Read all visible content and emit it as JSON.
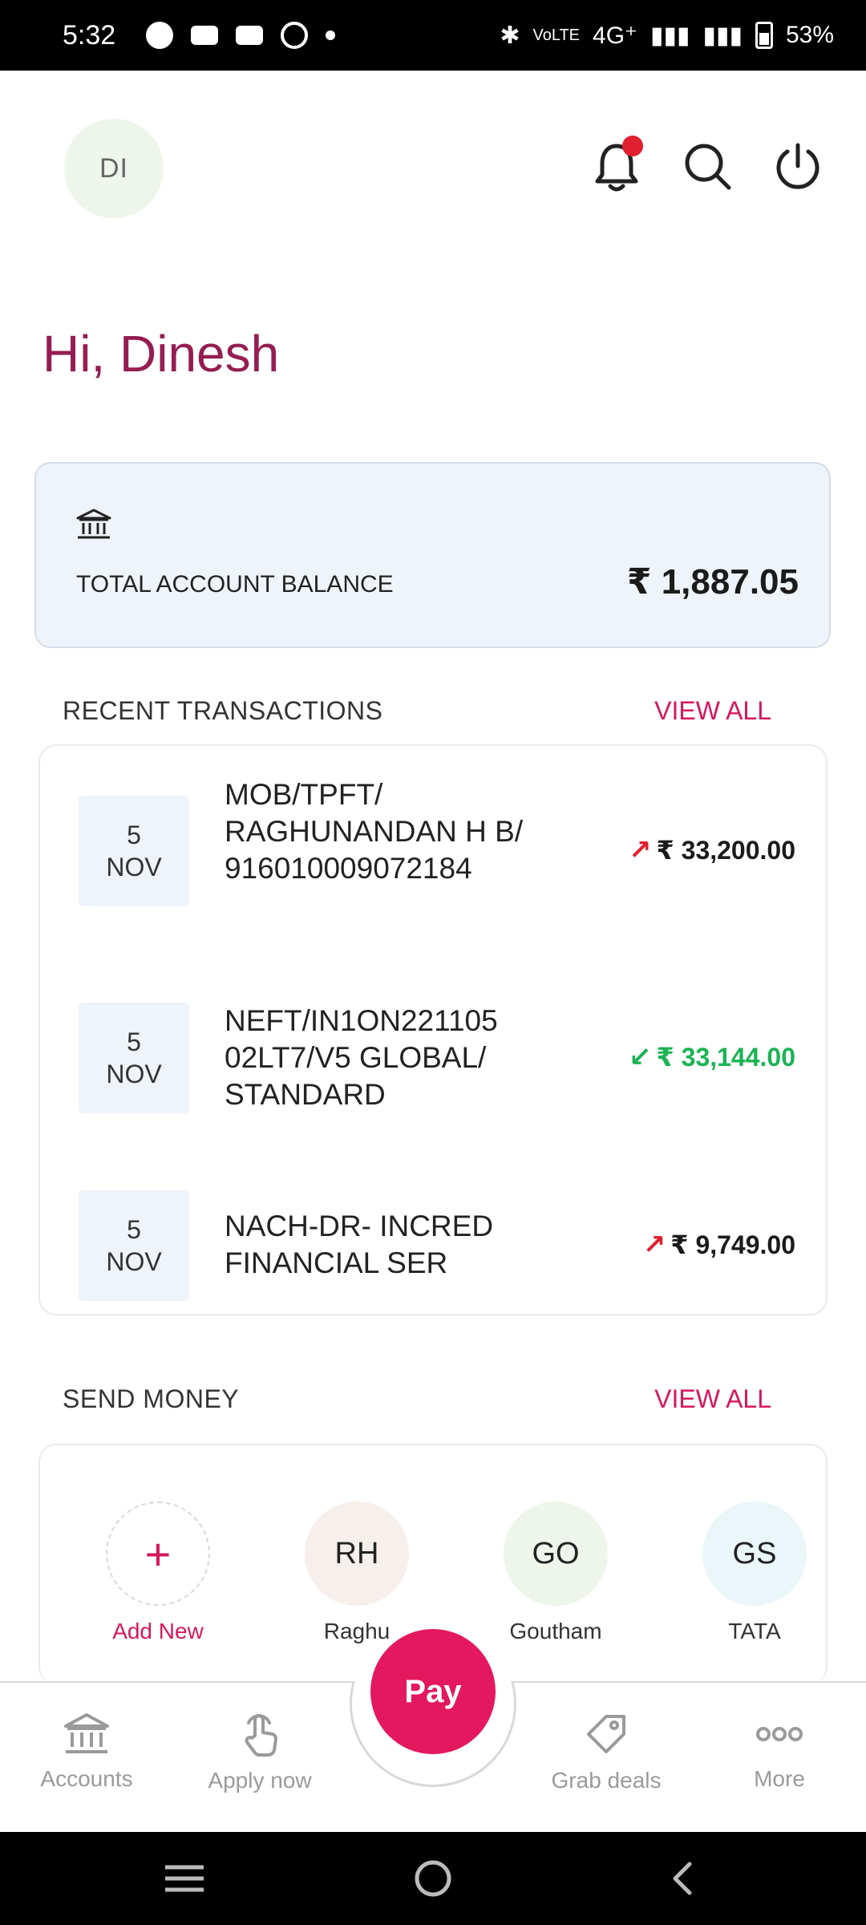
{
  "status_bar": {
    "time": "5:32",
    "network": "4G⁺",
    "battery": "53%"
  },
  "header": {
    "avatar_initials": "DI",
    "notification_badge": true
  },
  "greeting": "Hi, Dinesh",
  "balance": {
    "label": "TOTAL ACCOUNT BALANCE",
    "value": "₹ 1,887.05"
  },
  "recent_transactions": {
    "title": "RECENT TRANSACTIONS",
    "view_all": "VIEW ALL",
    "items": [
      {
        "day": "5",
        "month": "NOV",
        "description": "MOB/TPFT/ RAGHUNANDAN H B/ 916010009072184",
        "amount": "₹ 33,200.00",
        "direction": "out"
      },
      {
        "day": "5",
        "month": "NOV",
        "description": "NEFT/IN1ON221105 02LT7/V5 GLOBAL/ STANDARD",
        "amount": "₹ 33,144.00",
        "direction": "in"
      },
      {
        "day": "5",
        "month": "NOV",
        "description": "NACH-DR- INCRED FINANCIAL SER",
        "amount": "₹ 9,749.00",
        "direction": "out"
      }
    ]
  },
  "send_money": {
    "title": "SEND MONEY",
    "view_all": "VIEW ALL",
    "add_new": {
      "symbol": "+",
      "label": "Add New"
    },
    "contacts": [
      {
        "initials": "RH",
        "name": "Raghu",
        "color": "#f6efeb"
      },
      {
        "initials": "GO",
        "name": "Goutham",
        "color": "#eef5ea"
      },
      {
        "initials": "GS",
        "name": "TATA",
        "color": "#eaf6f7"
      }
    ]
  },
  "bottom_nav": {
    "accounts": "Accounts",
    "apply_now": "Apply now",
    "pay": "Pay",
    "grab_deals": "Grab deals",
    "more": "More"
  },
  "colors": {
    "brand_pink": "#e4185e",
    "greeting": "#951d52",
    "credit_green": "#1bb354",
    "debit_red": "#e0202e"
  }
}
